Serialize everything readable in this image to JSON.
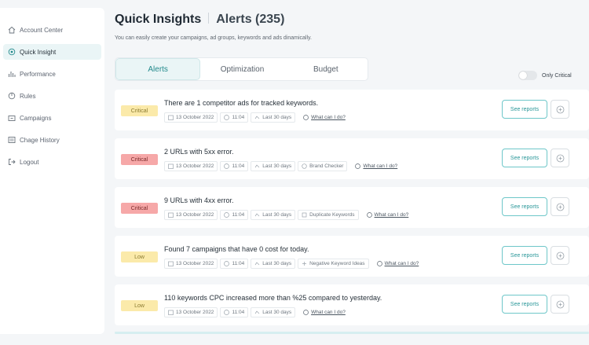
{
  "sidebar": {
    "items": [
      {
        "label": "Account Center",
        "icon": "home-icon"
      },
      {
        "label": "Quick Insight",
        "icon": "insight-icon"
      },
      {
        "label": "Performance",
        "icon": "bar-chart-icon"
      },
      {
        "label": "Rules",
        "icon": "rules-icon"
      },
      {
        "label": "Campaigns",
        "icon": "folder-icon"
      },
      {
        "label": "Chage History",
        "icon": "history-icon"
      },
      {
        "label": "Logout",
        "icon": "logout-icon"
      }
    ],
    "active_index": 1
  },
  "header": {
    "title": "Quick Insights",
    "subtitle": "Alerts (235)",
    "description": "You can easily create your campaigns, ad groups, keywords and ads dinamically."
  },
  "tabs": [
    {
      "label": "Alerts",
      "active": true
    },
    {
      "label": "Optimization",
      "active": false
    },
    {
      "label": "Budget",
      "active": false
    }
  ],
  "toggle": {
    "label": "Only Critical",
    "on": false
  },
  "alerts": [
    {
      "severity": "Critical",
      "badge_color": "#fbeaaa",
      "title": "There are 1 competitor ads for tracked keywords.",
      "date": "13 October 2022",
      "time": "11:04",
      "range": "Last 30 days",
      "tool": "",
      "help": "What can I do?",
      "action": "See reports"
    },
    {
      "severity": "Critical",
      "badge_color": "#f6a8a8",
      "title": "2 URLs with 5xx error.",
      "date": "13 October 2022",
      "time": "11:04",
      "range": "Last 30 days",
      "tool": "Brand Checker",
      "help": "What can I do?",
      "action": "See reports"
    },
    {
      "severity": "Critical",
      "badge_color": "#f6a8a8",
      "title": "9 URLs with 4xx error.",
      "date": "13 October 2022",
      "time": "11:04",
      "range": "Last 30 days",
      "tool": "Duplicate Keywords",
      "help": "What can I do?",
      "action": "See reports"
    },
    {
      "severity": "Low",
      "badge_color": "#fbeaaa",
      "title": "Found 7 campaigns that have 0 cost for today.",
      "date": "13 October 2022",
      "time": "11:04",
      "range": "Last 30 days",
      "tool": "Negative Keyword Ideas",
      "help": "What can I do?",
      "action": "See reports"
    },
    {
      "severity": "Low",
      "badge_color": "#fbeaaa",
      "title": "110 keywords CPC increased more than %25 compared to yesterday.",
      "date": "13 October 2022",
      "time": "11:04",
      "range": "Last 30 days",
      "tool": "",
      "help": "What can I do?",
      "action": "See reports"
    }
  ],
  "colors": {
    "accent": "#2a9799",
    "critical_red": "#f6a8a8",
    "yellow": "#fbeaaa"
  }
}
